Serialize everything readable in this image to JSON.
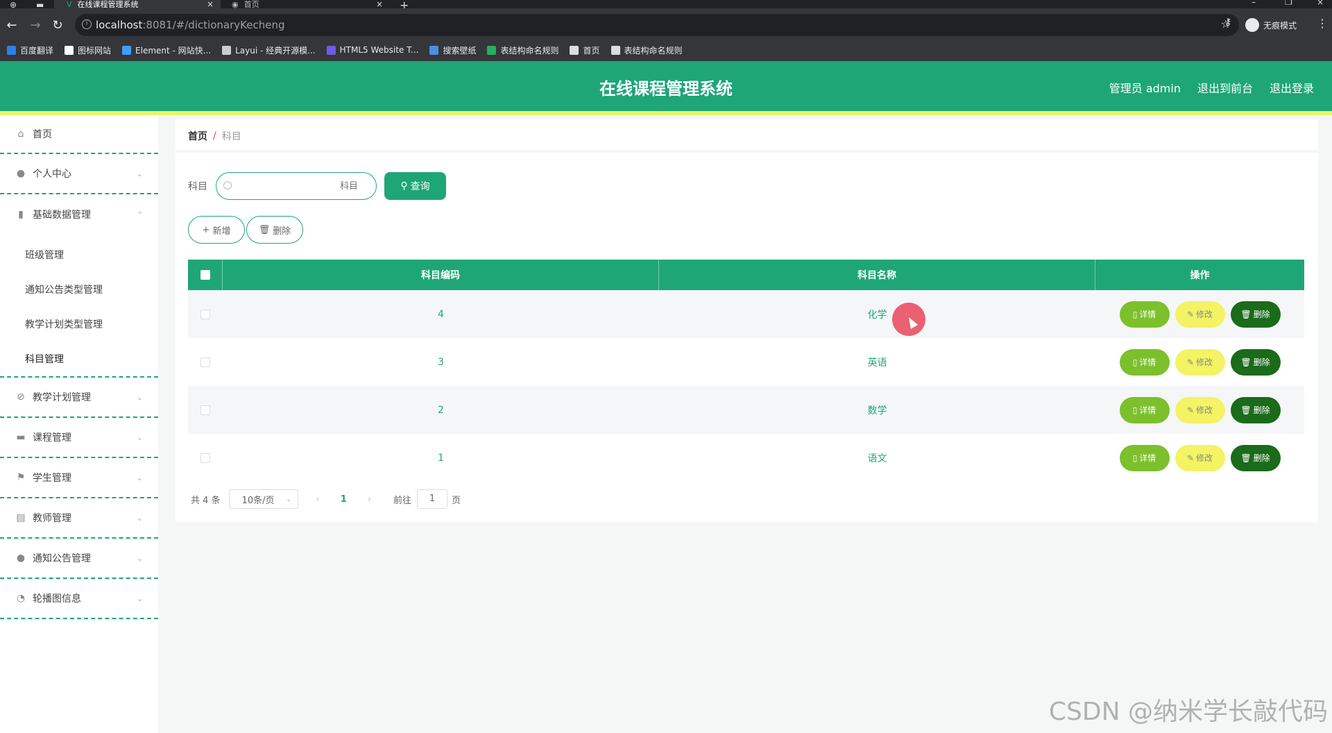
{
  "browser": {
    "tabs": [
      {
        "title": "在线课程管理系统",
        "active": true
      },
      {
        "title": "首页",
        "active": false
      }
    ],
    "url_host": "localhost",
    "url_rest": ":8081/#/dictionaryKecheng",
    "incognito_label": "无痕模式",
    "bookmarks": [
      {
        "label": "百度翻译",
        "color": "#2f80ed"
      },
      {
        "label": "图标网站",
        "color": "#ffffff"
      },
      {
        "label": "Element - 网站快...",
        "color": "#409eff"
      },
      {
        "label": "Layui - 经典开源模...",
        "color": "#cccccc"
      },
      {
        "label": "HTML5 Website T...",
        "color": "#6c5ce7"
      },
      {
        "label": "搜索壁纸",
        "color": "#4a90e2"
      },
      {
        "label": "表结构命名规则",
        "color": "#27ae60"
      },
      {
        "label": "首页",
        "color": "#dddddd"
      },
      {
        "label": "表结构命名规则",
        "color": "#dddddd"
      }
    ]
  },
  "header": {
    "title": "在线课程管理系统",
    "user": "管理员 admin",
    "to_front": "退出到前台",
    "logout": "退出登录",
    "colors": {
      "primary": "#1ea677",
      "stripe": "#e8f56a"
    }
  },
  "sidebar": {
    "home": "首页",
    "items": [
      {
        "label": "个人中心",
        "icon": "user-icon"
      },
      {
        "label": "基础数据管理",
        "icon": "bar-chart-icon",
        "expanded": true,
        "children": [
          "班级管理",
          "通知公告类型管理",
          "教学计划类型管理",
          "科目管理"
        ]
      },
      {
        "label": "教学计划管理",
        "icon": "bell-off-icon"
      },
      {
        "label": "课程管理",
        "icon": "briefcase-icon"
      },
      {
        "label": "学生管理",
        "icon": "flag-icon"
      },
      {
        "label": "教师管理",
        "icon": "clipboard-icon"
      },
      {
        "label": "通知公告管理",
        "icon": "user-icon"
      },
      {
        "label": "轮播图信息",
        "icon": "gauge-icon"
      }
    ]
  },
  "breadcrumb": {
    "home": "首页",
    "separator": "/",
    "current": "科目"
  },
  "search": {
    "label": "科目",
    "placeholder": "科目",
    "button": "查询"
  },
  "actions": {
    "add": "新增",
    "delete": "删除"
  },
  "table": {
    "headers": [
      "科目编码",
      "科目名称",
      "操作"
    ],
    "rows": [
      {
        "code": "4",
        "name": "化学"
      },
      {
        "code": "3",
        "name": "英语"
      },
      {
        "code": "2",
        "name": "数学"
      },
      {
        "code": "1",
        "name": "语文"
      }
    ],
    "ops": {
      "detail": "详情",
      "edit": "修改",
      "delete": "删除"
    }
  },
  "pagination": {
    "total": "共 4 条",
    "page_size": "10条/页",
    "current_page": "1",
    "goto_label": "前往",
    "goto_value": "1",
    "page_unit": "页"
  },
  "watermark": "CSDN @纳米学长敲代码"
}
